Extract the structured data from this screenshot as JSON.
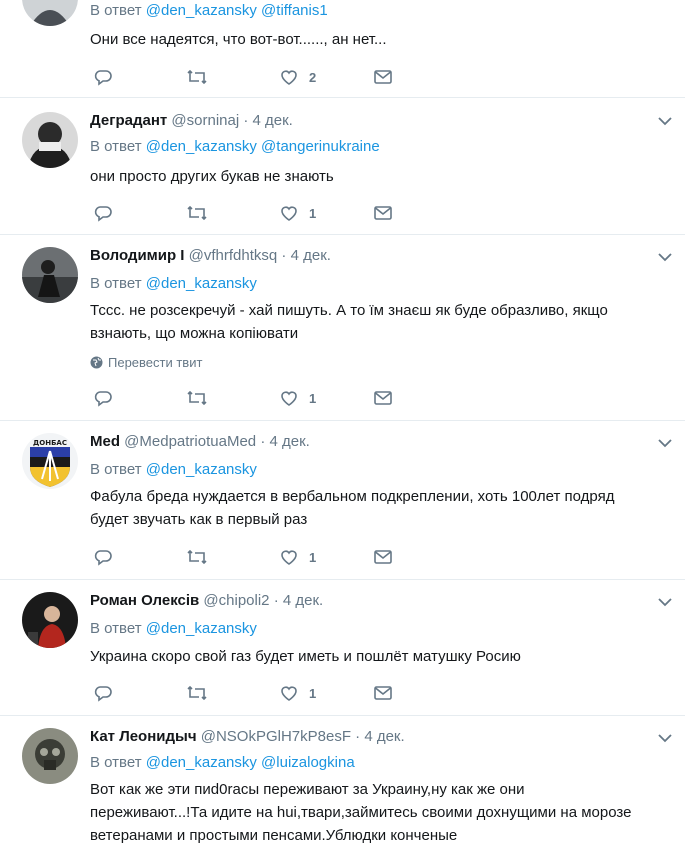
{
  "reply_prefix": "В ответ",
  "translate_label": "Перевести твит",
  "tweets": [
    {
      "name": "",
      "handle": "",
      "time": "",
      "reply_to": [
        "@den_kazansky",
        "@tiffanis1"
      ],
      "text": "Они все надеятся, что вот-вот......, ан нет...",
      "likes": "2"
    },
    {
      "name": "Деградант",
      "handle": "@sorninaj",
      "time": "4 дек.",
      "reply_to": [
        "@den_kazansky",
        "@tangerinukraine"
      ],
      "text": "они просто других букав не знають",
      "likes": "1"
    },
    {
      "name": "Володимир І",
      "handle": "@vfhrfdhtksq",
      "time": "4 дек.",
      "reply_to": [
        "@den_kazansky"
      ],
      "text_lines": [
        "Тссс. не розсекречуй - хай пишуть. А то їм знаєш як буде образливо, якщо",
        "взнають, що можна копіювати"
      ],
      "likes": "1"
    },
    {
      "name": "Med",
      "handle": "@MedpatriotuaMed",
      "time": "4 дек.",
      "reply_to": [
        "@den_kazansky"
      ],
      "text_lines": [
        "Фабула бреда нуждается в вербальном подкреплении, хоть 100лет подряд",
        "будет звучать как в первый раз"
      ],
      "likes": "1",
      "avatar_text": "ДОНБАС"
    },
    {
      "name": "Роман Олексів",
      "handle": "@chipoli2",
      "time": "4 дек.",
      "reply_to": [
        "@den_kazansky"
      ],
      "text": "Украина скоро свой газ будет иметь и пошлёт матушку Росию",
      "likes": "1"
    },
    {
      "name": "Кат Леонидыч",
      "handle": "@NSOkPGlH7kP8esF",
      "time": "4 дек.",
      "reply_to": [
        "@den_kazansky",
        "@luizalogkina"
      ],
      "text_lines": [
        "Вот как же эти пиd0racы переживают за Украину,ну как же они",
        "переживают...!Та идите на hui,твари,займитесь своими дохнущими на морозе",
        "ветеранами и простыми пенсами.Ублюдки конченые"
      ],
      "likes": ""
    }
  ]
}
